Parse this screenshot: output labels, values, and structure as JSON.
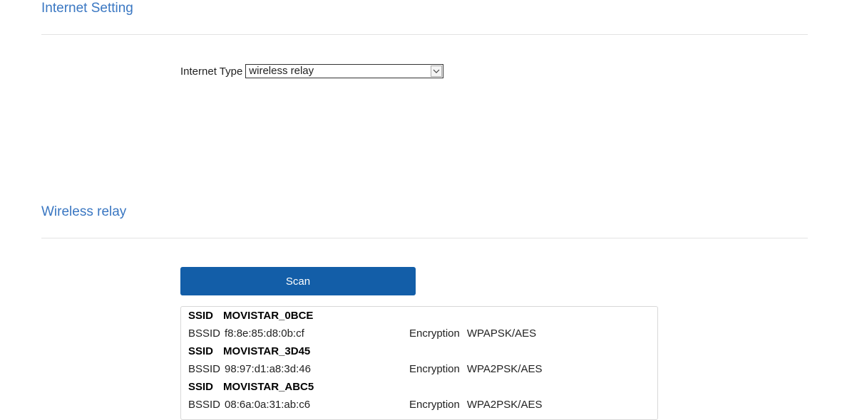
{
  "sections": {
    "internet_setting_title": "Internet Setting",
    "wireless_relay_title": "Wireless relay"
  },
  "internet_type": {
    "label": "Internet Type",
    "selected": "wireless relay"
  },
  "scan": {
    "button_label": "Scan"
  },
  "networks": [
    {
      "ssid_label": "SSID",
      "ssid": "MOVISTAR_0BCE",
      "bssid_label": "BSSID",
      "bssid": "f8:8e:85:d8:0b:cf",
      "encryption_label": "Encryption",
      "encryption": "WPAPSK/AES"
    },
    {
      "ssid_label": "SSID",
      "ssid": "MOVISTAR_3D45",
      "bssid_label": "BSSID",
      "bssid": "98:97:d1:a8:3d:46",
      "encryption_label": "Encryption",
      "encryption": "WPA2PSK/AES"
    },
    {
      "ssid_label": "SSID",
      "ssid": "MOVISTAR_ABC5",
      "bssid_label": "BSSID",
      "bssid": "08:6a:0a:31:ab:c6",
      "encryption_label": "Encryption",
      "encryption": "WPA2PSK/AES"
    }
  ],
  "colors": {
    "section_title": "#3a77c2",
    "scan_button": "#135ea8"
  },
  "icons": {
    "select_arrow": "chevron-down-icon"
  }
}
